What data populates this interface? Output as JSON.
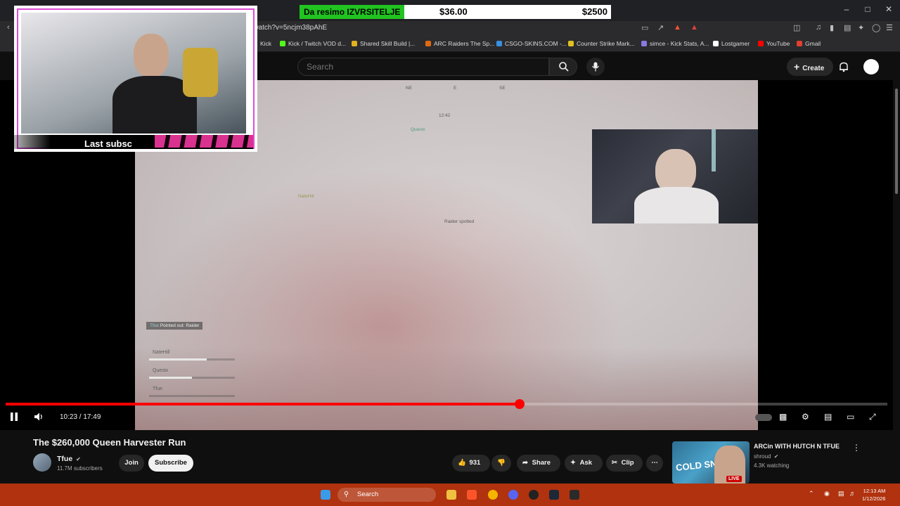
{
  "browser": {
    "url": "n/watch?v=5ncjm38pAhE",
    "bookmarks": [
      {
        "label": "Kick",
        "color": "#53fc18"
      },
      {
        "label": "Kick / Twitch VOD d...",
        "color": "#53fc18"
      },
      {
        "label": "Shared Skill Build |...",
        "color": "#e0b020"
      },
      {
        "label": "ARC Raiders The Sp...",
        "color": "#e06a10"
      },
      {
        "label": "CSGO-SKINS.COM -...",
        "color": "#3a8fe0"
      },
      {
        "label": "Counter Strike Mark...",
        "color": "#e0c020"
      },
      {
        "label": "simce - Kick Stats, A...",
        "color": "#8a7ae0"
      },
      {
        "label": "Lostgamer",
        "color": "#ffffff"
      },
      {
        "label": "YouTube",
        "color": "#ff0000"
      },
      {
        "label": "Gmail",
        "color": "#e04030"
      }
    ]
  },
  "overlay": {
    "donation_label": "Da resimo IZVRSITELJE",
    "donation_current": "$36.00",
    "donation_goal": "$2500",
    "subscriber_text": "Last subsc"
  },
  "header": {
    "search_placeholder": "Search",
    "create_label": "Create"
  },
  "game_hud": {
    "compass_ne": "NE",
    "compass_e": "E",
    "compass_se": "SE",
    "timer": "12:42",
    "marker_questx": "Questx",
    "marker_natehill": "NateHill",
    "marker_raider": "Raider spotted",
    "point_tag_name": "Tfue",
    "point_tag_text": "Pointed out: Raider",
    "squad": [
      {
        "name": "NateHill",
        "health": 0.67
      },
      {
        "name": "Questx",
        "health": 0.5
      },
      {
        "name": "Tfue",
        "health": 0.0
      }
    ]
  },
  "player": {
    "time_current": "10:23",
    "time_total": "17:49",
    "time_display": "10:23 / 17:49",
    "progress": 0.583
  },
  "video_info": {
    "title": "The $260,000 Queen Harvester Run",
    "channel": "Tfue",
    "subscribers": "11.7M subscribers",
    "join_label": "Join",
    "subscribe_label": "Subscribe",
    "likes": "931",
    "share_label": "Share",
    "ask_label": "Ask",
    "clip_label": "Clip"
  },
  "recommendation": {
    "title": "ARCin WITH HUTCH N TFUE",
    "channel": "shroud",
    "watching": "4.3K watching",
    "live_badge": "LIVE",
    "thumb_text": "COLD SNAP"
  },
  "taskbar": {
    "search_label": "Search",
    "time": "12:13 AM",
    "date": "1/12/2026"
  },
  "colors": {
    "accent_red": "#ff0000",
    "taskbar": "#b0320e",
    "donation_green": "#21c321"
  }
}
